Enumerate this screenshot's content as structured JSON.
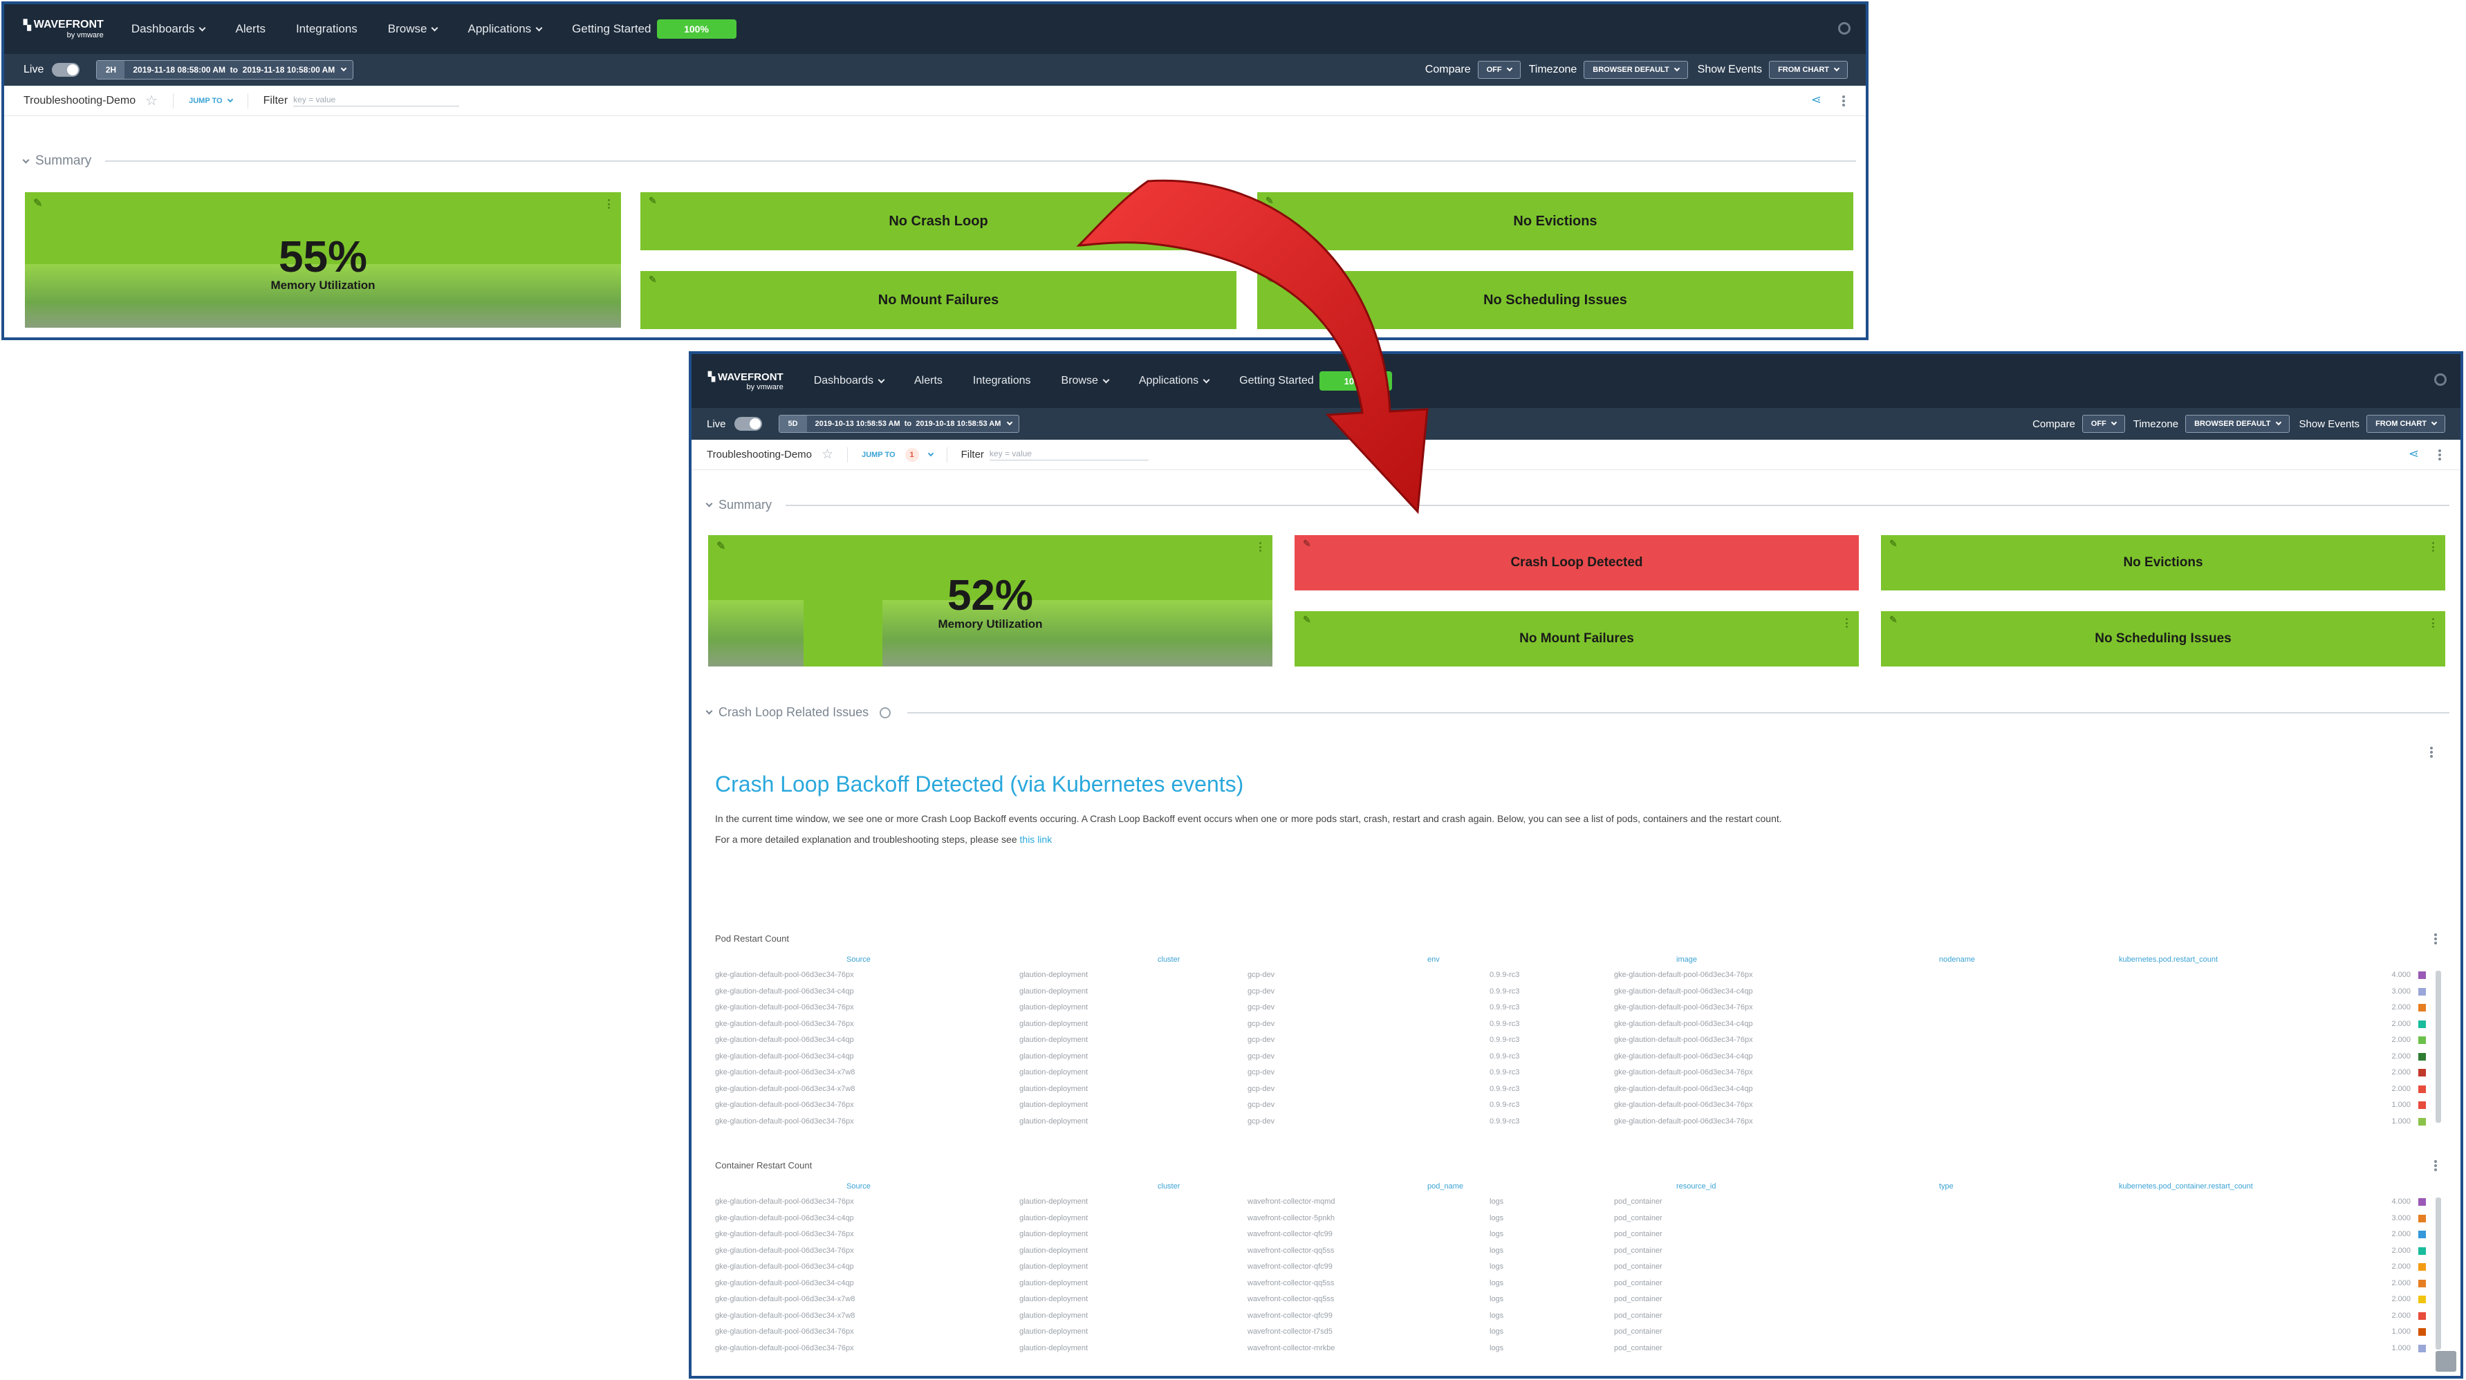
{
  "nav": {
    "brand": "WAVEFRONT",
    "brand_sub": "by vmware",
    "items": [
      "Dashboards",
      "Alerts",
      "Integrations",
      "Browse",
      "Applications",
      "Getting Started"
    ],
    "progress": "100%"
  },
  "toolbar": {
    "live_label": "Live",
    "compare_label": "Compare",
    "compare_value": "OFF",
    "timezone_label": "Timezone",
    "timezone_value": "BROWSER DEFAULT",
    "events_label": "Show Events",
    "events_value": "FROM CHART"
  },
  "before": {
    "range_btn": "2H",
    "time_range": "2019-11-18 08:58:00 AM  to  2019-11-18 10:58:00 AM",
    "dashboard": "Troubleshooting-Demo",
    "jump_to": "JUMP TO",
    "filter_label": "Filter",
    "filter_placeholder": "key = value",
    "summary": "Summary",
    "memory_value": "55%",
    "memory_label": "Memory Utilization",
    "tile_crash": "No Crash Loop",
    "tile_evictions": "No Evictions",
    "tile_mount": "No Mount Failures",
    "tile_scheduling": "No Scheduling Issues"
  },
  "after": {
    "range_btn": "5D",
    "time_range": "2019-10-13 10:58:53 AM  to  2019-10-18 10:58:53 AM",
    "dashboard": "Troubleshooting-Demo",
    "jump_to": "JUMP TO",
    "jump_badge": "1",
    "filter_label": "Filter",
    "filter_placeholder": "key = value",
    "summary": "Summary",
    "memory_value": "52%",
    "memory_label": "Memory Utilization",
    "tile_crash": "Crash Loop Detected",
    "tile_evictions": "No Evictions",
    "tile_mount": "No Mount Failures",
    "tile_scheduling": "No Scheduling Issues",
    "crash_section": "Crash Loop Related Issues",
    "crash_title": "Crash Loop Backoff Detected (via Kubernetes events)",
    "crash_para1": "In the current time window, we see one or more Crash Loop Backoff events occuring. A Crash Loop Backoff event occurs when one or more pods start, crash, restart and crash again. Below, you can see a list of pods, containers and the restart count.",
    "crash_para2": "For a more detailed explanation and troubleshooting steps, please see ",
    "crash_link": "this link",
    "pod_table": {
      "title": "Pod Restart Count",
      "columns": [
        "Source",
        "cluster",
        "env",
        "image",
        "nodename",
        "kubernetes.pod.restart_count"
      ],
      "rows": [
        [
          "gke-glaution-default-pool-06d3ec34-76px",
          "glaution-deployment",
          "gcp-dev",
          "0.9.9-rc3",
          "gke-glaution-default-pool-06d3ec34-76px",
          "4.000",
          "#9b59b6"
        ],
        [
          "gke-glaution-default-pool-06d3ec34-c4qp",
          "glaution-deployment",
          "gcp-dev",
          "0.9.9-rc3",
          "gke-glaution-default-pool-06d3ec34-c4qp",
          "3.000",
          "#9aa7d8"
        ],
        [
          "gke-glaution-default-pool-06d3ec34-76px",
          "glaution-deployment",
          "gcp-dev",
          "0.9.9-rc3",
          "gke-glaution-default-pool-06d3ec34-76px",
          "2.000",
          "#e67e22"
        ],
        [
          "gke-glaution-default-pool-06d3ec34-76px",
          "glaution-deployment",
          "gcp-dev",
          "0.9.9-rc3",
          "gke-glaution-default-pool-06d3ec34-c4qp",
          "2.000",
          "#1abc9c"
        ],
        [
          "gke-glaution-default-pool-06d3ec34-c4qp",
          "glaution-deployment",
          "gcp-dev",
          "0.9.9-rc3",
          "gke-glaution-default-pool-06d3ec34-76px",
          "2.000",
          "#6cc04a"
        ],
        [
          "gke-glaution-default-pool-06d3ec34-c4qp",
          "glaution-deployment",
          "gcp-dev",
          "0.9.9-rc3",
          "gke-glaution-default-pool-06d3ec34-c4qp",
          "2.000",
          "#2e7d32"
        ],
        [
          "gke-glaution-default-pool-06d3ec34-x7w8",
          "glaution-deployment",
          "gcp-dev",
          "0.9.9-rc3",
          "gke-glaution-default-pool-06d3ec34-76px",
          "2.000",
          "#c0392b"
        ],
        [
          "gke-glaution-default-pool-06d3ec34-x7w8",
          "glaution-deployment",
          "gcp-dev",
          "0.9.9-rc3",
          "gke-glaution-default-pool-06d3ec34-c4qp",
          "2.000",
          "#e74c3c"
        ],
        [
          "gke-glaution-default-pool-06d3ec34-76px",
          "glaution-deployment",
          "gcp-dev",
          "0.9.9-rc3",
          "gke-glaution-default-pool-06d3ec34-76px",
          "1.000",
          "#e74c3c"
        ],
        [
          "gke-glaution-default-pool-06d3ec34-76px",
          "glaution-deployment",
          "gcp-dev",
          "0.9.9-rc3",
          "gke-glaution-default-pool-06d3ec34-76px",
          "1.000",
          "#8bc34a"
        ]
      ]
    },
    "container_table": {
      "title": "Container Restart Count",
      "columns": [
        "Source",
        "cluster",
        "pod_name",
        "resource_id",
        "type",
        "kubernetes.pod_container.restart_count"
      ],
      "rows": [
        [
          "gke-glaution-default-pool-06d3ec34-76px",
          "glaution-deployment",
          "wavefront-collector-mqmd",
          "logs",
          "pod_container",
          "4.000",
          "#9b59b6"
        ],
        [
          "gke-glaution-default-pool-06d3ec34-c4qp",
          "glaution-deployment",
          "wavefront-collector-5pnkh",
          "logs",
          "pod_container",
          "3.000",
          "#e67e22"
        ],
        [
          "gke-glaution-default-pool-06d3ec34-76px",
          "glaution-deployment",
          "wavefront-collector-qfc99",
          "logs",
          "pod_container",
          "2.000",
          "#3498db"
        ],
        [
          "gke-glaution-default-pool-06d3ec34-76px",
          "glaution-deployment",
          "wavefront-collector-qq5ss",
          "logs",
          "pod_container",
          "2.000",
          "#1abc9c"
        ],
        [
          "gke-glaution-default-pool-06d3ec34-c4qp",
          "glaution-deployment",
          "wavefront-collector-qfc99",
          "logs",
          "pod_container",
          "2.000",
          "#f39c12"
        ],
        [
          "gke-glaution-default-pool-06d3ec34-c4qp",
          "glaution-deployment",
          "wavefront-collector-qq5ss",
          "logs",
          "pod_container",
          "2.000",
          "#e67e22"
        ],
        [
          "gke-glaution-default-pool-06d3ec34-x7w8",
          "glaution-deployment",
          "wavefront-collector-qq5ss",
          "logs",
          "pod_container",
          "2.000",
          "#f1c40f"
        ],
        [
          "gke-glaution-default-pool-06d3ec34-x7w8",
          "glaution-deployment",
          "wavefront-collector-qfc99",
          "logs",
          "pod_container",
          "2.000",
          "#e74c3c"
        ],
        [
          "gke-glaution-default-pool-06d3ec34-76px",
          "glaution-deployment",
          "wavefront-collector-t7sd5",
          "logs",
          "pod_container",
          "1.000",
          "#d35400"
        ],
        [
          "gke-glaution-default-pool-06d3ec34-76px",
          "glaution-deployment",
          "wavefront-collector-mrkbe",
          "logs",
          "pod_container",
          "1.000",
          "#9aa7d8"
        ]
      ]
    }
  },
  "colors": {
    "nav_bg": "#1c2a3a",
    "toolbar_bg": "#2a3b4e",
    "tile_green": "#7dc42c",
    "tile_red": "#ea4a4d",
    "accent_blue": "#2aa8dc",
    "arrow_red": "#d41e1e",
    "frame_blue": "#1f4f8c"
  }
}
